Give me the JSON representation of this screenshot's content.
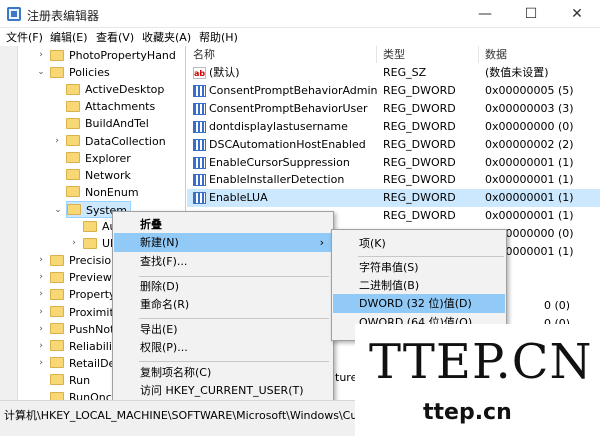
{
  "window": {
    "title": "注册表编辑器",
    "minimize": "—",
    "maximize": "☐",
    "close": "✕"
  },
  "menu": [
    "文件(F)",
    "编辑(E)",
    "查看(V)",
    "收藏夹(A)",
    "帮助(H)"
  ],
  "tree": [
    {
      "label": "PhotoPropertyHand",
      "level": 1,
      "expander": "›"
    },
    {
      "label": "Policies",
      "level": 1,
      "expander": "⌄"
    },
    {
      "label": "ActiveDesktop",
      "level": 2,
      "expander": ""
    },
    {
      "label": "Attachments",
      "level": 2,
      "expander": ""
    },
    {
      "label": "BuildAndTel",
      "level": 2,
      "expander": ""
    },
    {
      "label": "DataCollection",
      "level": 2,
      "expander": "›"
    },
    {
      "label": "Explorer",
      "level": 2,
      "expander": ""
    },
    {
      "label": "Network",
      "level": 2,
      "expander": ""
    },
    {
      "label": "NonEnum",
      "level": 2,
      "expander": ""
    },
    {
      "label": "System",
      "level": 2,
      "expander": "⌄",
      "selected": true
    },
    {
      "label": "Au",
      "level": 3,
      "expander": ""
    },
    {
      "label": "UI",
      "level": 3,
      "expander": "›"
    },
    {
      "label": "Precision",
      "level": 1,
      "expander": "›"
    },
    {
      "label": "PreviewH",
      "level": 1,
      "expander": "›"
    },
    {
      "label": "Property",
      "level": 1,
      "expander": "›"
    },
    {
      "label": "Proximity",
      "level": 1,
      "expander": "›"
    },
    {
      "label": "PushNot",
      "level": 1,
      "expander": "›"
    },
    {
      "label": "Reliabilit",
      "level": 1,
      "expander": "›"
    },
    {
      "label": "RetailDe",
      "level": 1,
      "expander": "›"
    },
    {
      "label": "Run",
      "level": 1,
      "expander": ""
    },
    {
      "label": "RunOnce",
      "level": 1,
      "expander": ""
    }
  ],
  "columns": {
    "name": "名称",
    "type": "类型",
    "data": "数据"
  },
  "values": [
    {
      "name": "(默认)",
      "type": "REG_SZ",
      "data": "(数值未设置)",
      "icon": "ab"
    },
    {
      "name": "ConsentPromptBehaviorAdmin",
      "type": "REG_DWORD",
      "data": "0x00000005 (5)",
      "icon": "dw"
    },
    {
      "name": "ConsentPromptBehaviorUser",
      "type": "REG_DWORD",
      "data": "0x00000003 (3)",
      "icon": "dw"
    },
    {
      "name": "dontdisplaylastusername",
      "type": "REG_DWORD",
      "data": "0x00000000 (0)",
      "icon": "dw"
    },
    {
      "name": "DSCAutomationHostEnabled",
      "type": "REG_DWORD",
      "data": "0x00000002 (2)",
      "icon": "dw"
    },
    {
      "name": "EnableCursorSuppression",
      "type": "REG_DWORD",
      "data": "0x00000001 (1)",
      "icon": "dw"
    },
    {
      "name": "EnableInstallerDetection",
      "type": "REG_DWORD",
      "data": "0x00000001 (1)",
      "icon": "dw"
    },
    {
      "name": "EnableLUA",
      "type": "REG_DWORD",
      "data": "0x00000001 (1)",
      "icon": "dw",
      "selected": true
    },
    {
      "name": "",
      "type": "REG_DWORD",
      "data": "0x00000001 (1)",
      "icon": ""
    },
    {
      "name": "",
      "type": "",
      "data": "0x00000000 (0)",
      "icon": ""
    },
    {
      "name": "",
      "type": "",
      "data": "0x00000001 (1)",
      "icon": ""
    }
  ],
  "partial_values": [
    "0 (0)",
    "0 (0)",
    "tures"
  ],
  "context_menu": {
    "collapse": "折叠",
    "new": "新建(N)",
    "new_arrow": "›",
    "find": "查找(F)...",
    "delete": "删除(D)",
    "rename": "重命名(R)",
    "export": "导出(E)",
    "permissions": "权限(P)...",
    "copy_key_name": "复制项名称(C)",
    "visit": "访问 HKEY_CURRENT_USER(T)"
  },
  "submenu": {
    "key": "项(K)",
    "string": "字符串值(S)",
    "binary": "二进制值(B)",
    "dword": "DWORD (32 位)值(D)",
    "qword": "QWORD (64 位)值(Q)"
  },
  "status": "计算机\\HKEY_LOCAL_MACHINE\\SOFTWARE\\Microsoft\\Windows\\CurrentVersion\\Policies\\System",
  "watermark": {
    "big": "TTEP.CN",
    "small": "ttep.cn"
  }
}
